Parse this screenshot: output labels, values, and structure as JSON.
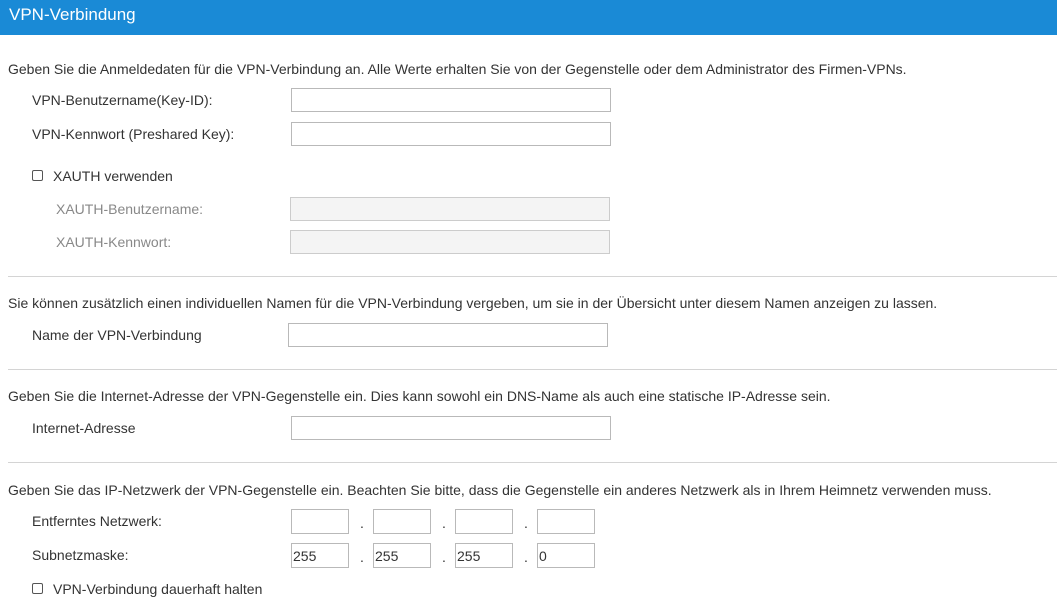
{
  "header": {
    "title": "VPN-Verbindung"
  },
  "credentials": {
    "intro": "Geben Sie die Anmeldedaten für die VPN-Verbindung an. Alle Werte erhalten Sie von der Gegenstelle oder dem Administrator des Firmen-VPNs.",
    "username_label": "VPN-Benutzername(Key-ID):",
    "username_value": "",
    "password_label": "VPN-Kennwort (Preshared Key):",
    "password_value": "",
    "xauth_label": "XAUTH verwenden",
    "xauth_checked": false,
    "xauth_username_label": "XAUTH-Benutzername:",
    "xauth_password_label": "XAUTH-Kennwort:"
  },
  "name_section": {
    "intro": "Sie können zusätzlich einen individuellen Namen für die VPN-Verbindung vergeben, um sie in der Übersicht unter diesem Namen anzeigen zu lassen.",
    "label": "Name der VPN-Verbindung",
    "value": ""
  },
  "address_section": {
    "intro": "Geben Sie die Internet-Adresse der VPN-Gegenstelle ein. Dies kann sowohl ein DNS-Name als auch eine statische IP-Adresse sein.",
    "label": "Internet-Adresse",
    "value": ""
  },
  "network_section": {
    "intro": "Geben Sie das IP-Netzwerk der VPN-Gegenstelle ein. Beachten Sie bitte, dass die Gegenstelle ein anderes Netzwerk als in Ihrem Heimnetz verwenden muss.",
    "network_label": "Entferntes Netzwerk:",
    "network_octets": [
      "",
      "",
      "",
      ""
    ],
    "mask_label": "Subnetzmaske:",
    "mask_octets": [
      "255",
      "255",
      "255",
      "0"
    ],
    "separator": ".",
    "keepalive_label": "VPN-Verbindung dauerhaft halten",
    "keepalive_checked": false
  }
}
